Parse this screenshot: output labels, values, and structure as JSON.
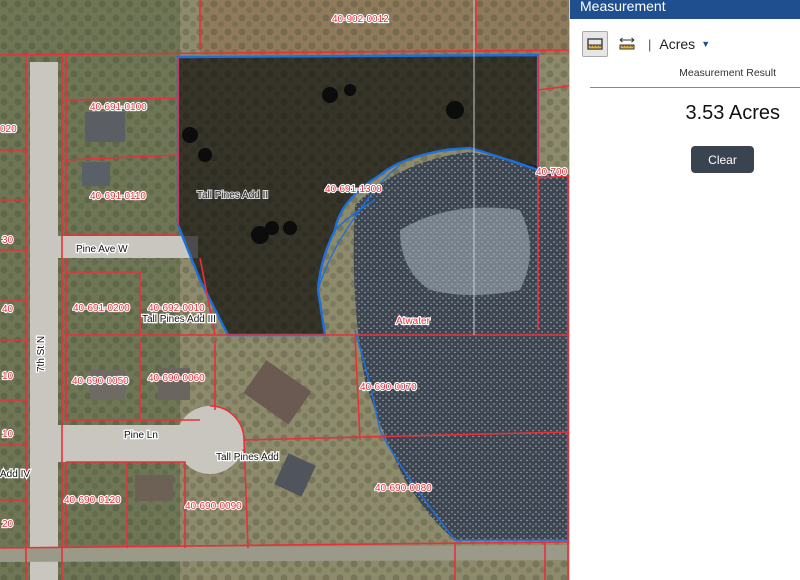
{
  "map": {
    "parcel_labels": {
      "p_40_902_0012": "40-902-0012",
      "p_40_691_0100": "40-691-0100",
      "p_40_691_0110": "40-691-0110",
      "p_40_691_1300": "40-691-1300",
      "p_40_700": "40-700",
      "p_40_691_0200": "40-691-0200",
      "p_40_692_0010": "40-692-0010",
      "p_40_690_0050": "40-690-0050",
      "p_40_690_0060": "40-690-0060",
      "p_40_690_0070": "40-690-0070",
      "p_40_690_0080": "40-690-0080",
      "p_40_690_0120": "40-690-0120",
      "p_40_690_0090": "40-690-0090",
      "p_020": "020",
      "p_30": "30",
      "p_40": "40",
      "p_10a": "10",
      "p_10b": "10",
      "p_20": "20"
    },
    "subdivision_labels": {
      "tall_pines_add_ii": "Tall Pines Add II",
      "tall_pines_add_iii": "Tall Pines Add III",
      "tall_pines_add": "Tall Pines Add",
      "add_iv": "Add IV",
      "atwater": "Atwater"
    },
    "street_labels": {
      "pine_ave_w": "Pine Ave W",
      "seventh_st_n": "7th St N",
      "pine_ln": "Pine Ln"
    },
    "colors": {
      "parcel_line": "#e8303a",
      "measure_line": "#1e6fd9",
      "measure_fill": "#000000"
    }
  },
  "panel": {
    "header_title": "Measurement",
    "toolbar": {
      "area_tool_icon": "area-measure-icon",
      "distance_tool_icon": "distance-measure-icon",
      "separator": "|",
      "unit_label": "Acres"
    },
    "result_title": "Measurement Result",
    "result_value": "3.53 Acres",
    "clear_label": "Clear"
  }
}
